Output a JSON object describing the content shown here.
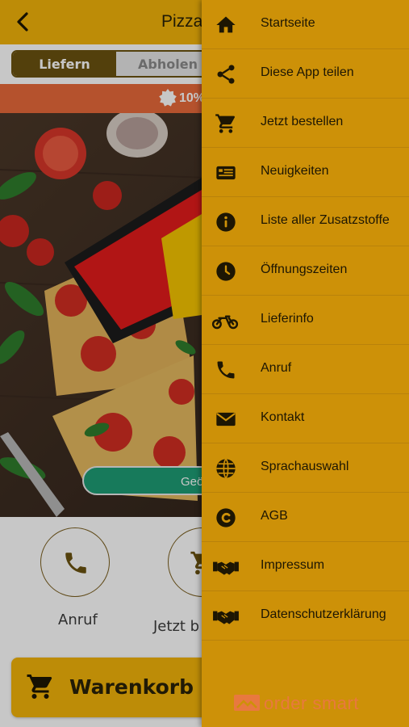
{
  "header": {
    "title": "Pizza"
  },
  "order_mode": {
    "deliver": "Liefern",
    "pickup": "Abholen"
  },
  "promo": {
    "text": "10%"
  },
  "hero": {
    "button_label": "Geö"
  },
  "actions": [
    {
      "label": "Anruf",
      "icon": "phone-icon"
    },
    {
      "label": "Jetzt b",
      "icon": "cart-icon"
    }
  ],
  "cart": {
    "label": "Warenkorb"
  },
  "drawer": {
    "items": [
      {
        "label": "Startseite",
        "icon": "home-icon"
      },
      {
        "label": "Diese App teilen",
        "icon": "share-icon"
      },
      {
        "label": "Jetzt bestellen",
        "icon": "cart-icon"
      },
      {
        "label": "Neuigkeiten",
        "icon": "news-icon"
      },
      {
        "label": "Liste aller Zusatzstoffe",
        "icon": "info-icon"
      },
      {
        "label": "Öffnungszeiten",
        "icon": "clock-icon"
      },
      {
        "label": "Lieferinfo",
        "icon": "motorcycle-icon"
      },
      {
        "label": "Anruf",
        "icon": "phone-icon"
      },
      {
        "label": "Kontakt",
        "icon": "envelope-icon"
      },
      {
        "label": "Sprachauswahl",
        "icon": "globe-icon"
      },
      {
        "label": "AGB",
        "icon": "copyright-icon"
      },
      {
        "label": "Impressum",
        "icon": "handshake-icon"
      },
      {
        "label": "Datenschutzerklärung",
        "icon": "handshake-icon"
      }
    ],
    "brand": "order smart"
  },
  "colors": {
    "accent": "#f2b409",
    "drawer": "#cd9108",
    "promo": "#e86a3a",
    "geo_button": "#1e9d75",
    "segment_active": "#6b5210"
  }
}
